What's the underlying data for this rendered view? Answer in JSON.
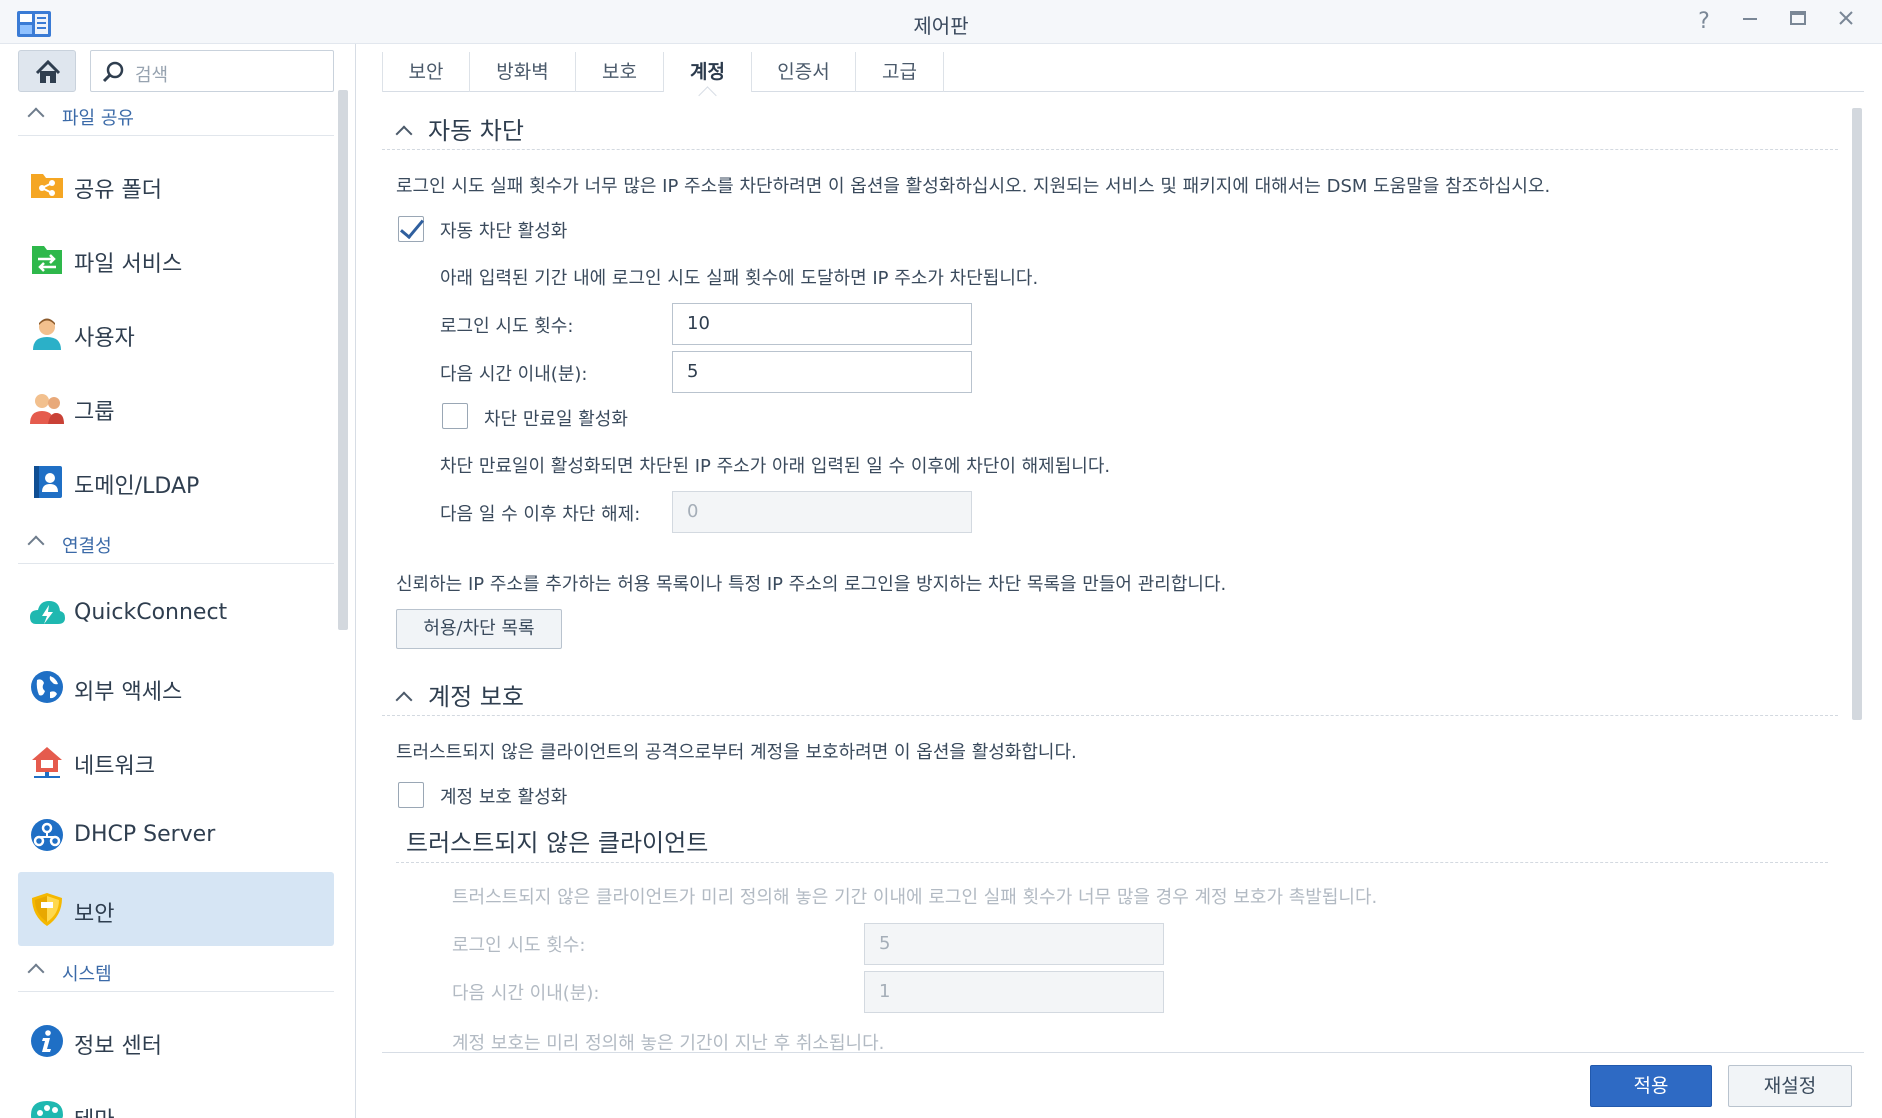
{
  "window": {
    "title": "제어판"
  },
  "search": {
    "placeholder": "검색"
  },
  "sidebar": {
    "sections": [
      {
        "label": "파일 공유"
      },
      {
        "label": "연결성"
      },
      {
        "label": "시스템"
      }
    ],
    "items": [
      {
        "label": "공유 폴더",
        "icon": "shared-folder-icon"
      },
      {
        "label": "파일 서비스",
        "icon": "file-services-icon"
      },
      {
        "label": "사용자",
        "icon": "user-icon"
      },
      {
        "label": "그룹",
        "icon": "group-icon"
      },
      {
        "label": "도메인/LDAP",
        "icon": "domain-ldap-icon"
      },
      {
        "label": "QuickConnect",
        "icon": "quickconnect-icon"
      },
      {
        "label": "외부 액세스",
        "icon": "external-access-icon"
      },
      {
        "label": "네트워크",
        "icon": "network-icon"
      },
      {
        "label": "DHCP Server",
        "icon": "dhcp-server-icon"
      },
      {
        "label": "보안",
        "icon": "security-shield-icon",
        "active": true
      },
      {
        "label": "정보 센터",
        "icon": "info-center-icon"
      },
      {
        "label": "테마",
        "icon": "theme-palette-icon"
      }
    ]
  },
  "tabs": [
    {
      "label": "보안"
    },
    {
      "label": "방화벽"
    },
    {
      "label": "보호"
    },
    {
      "label": "계정",
      "active": true
    },
    {
      "label": "인증서"
    },
    {
      "label": "고급"
    }
  ],
  "auto_block": {
    "title": "자동 차단",
    "description": "로그인 시도 실패 횟수가 너무 많은 IP 주소를 차단하려면 이 옵션을 활성화하십시오. 지원되는 서비스 및 패키지에 대해서는 DSM 도움말을 참조하십시오.",
    "enable_label": "자동 차단 활성화",
    "enable_checked": true,
    "rule_text": "아래 입력된 기간 내에 로그인 시도 실패 횟수에 도달하면 IP 주소가 차단됩니다.",
    "attempts_label": "로그인 시도 횟수:",
    "attempts_value": "10",
    "within_label": "다음 시간 이내(분):",
    "within_value": "5",
    "expiry_label": "차단 만료일 활성화",
    "expiry_checked": false,
    "expiry_text": "차단 만료일이 활성화되면 차단된 IP 주소가 아래 입력된 일 수 이후에 차단이 해제됩니다.",
    "unblock_label": "다음 일 수 이후 차단 해제:",
    "unblock_value": "0",
    "allowlist_text": "신뢰하는 IP 주소를 추가하는 허용 목록이나 특정 IP 주소의 로그인을 방지하는 차단 목록을 만들어 관리합니다.",
    "allowlist_button": "허용/차단 목록"
  },
  "account_protection": {
    "title": "계정 보호",
    "description": "트러스트되지 않은 클라이언트의 공격으로부터 계정을 보호하려면 이 옵션을 활성화합니다.",
    "enable_label": "계정 보호 활성화",
    "enable_checked": false,
    "untrusted": {
      "title": "트러스트되지 않은 클라이언트",
      "description": "트러스트되지 않은 클라이언트가 미리 정의해 놓은 기간 이내에 로그인 실패 횟수가 너무 많을 경우 계정 보호가 촉발됩니다.",
      "attempts_label": "로그인 시도 횟수:",
      "attempts_value": "5",
      "within_label": "다음 시간 이내(분):",
      "within_value": "1",
      "cancel_text": "계정 보호는 미리 정의해 놓은 기간이 지난 후 취소됩니다."
    }
  },
  "footer": {
    "apply": "적용",
    "reset": "재설정"
  },
  "colors": {
    "accent": "#2e6ac4",
    "active_nav": "#d6e5f4",
    "section_label": "#3b6aa8"
  }
}
